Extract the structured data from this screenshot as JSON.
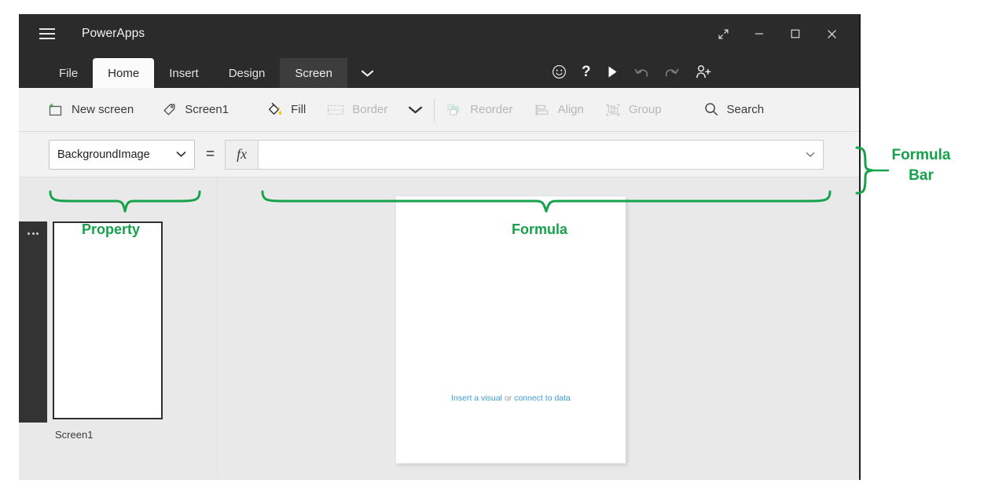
{
  "window": {
    "title": "PowerApps",
    "menu_icon": "hamburger-icon",
    "controls": [
      {
        "name": "restore-expand-button",
        "glyph": "⤢"
      },
      {
        "name": "minimize-button",
        "glyph": "—"
      },
      {
        "name": "maximize-button",
        "glyph": "▢"
      },
      {
        "name": "close-button",
        "glyph": "✕"
      }
    ]
  },
  "ribbon": {
    "tabs": [
      {
        "label": "File",
        "state": "normal"
      },
      {
        "label": "Home",
        "state": "active"
      },
      {
        "label": "Insert",
        "state": "normal"
      },
      {
        "label": "Design",
        "state": "normal"
      },
      {
        "label": "Screen",
        "state": "highlight"
      }
    ],
    "overflow_chevron": "❯",
    "actions": [
      {
        "name": "feedback-smiley-icon",
        "glyph": "☺",
        "state": "enabled"
      },
      {
        "name": "help-question-icon",
        "glyph": "?",
        "state": "enabled"
      },
      {
        "name": "play-preview-icon",
        "glyph": "▶",
        "state": "enabled"
      },
      {
        "name": "undo-icon",
        "glyph": "↺",
        "state": "disabled"
      },
      {
        "name": "redo-icon",
        "glyph": "↻",
        "state": "disabled"
      },
      {
        "name": "share-add-user-icon",
        "glyph": "",
        "state": "enabled"
      }
    ]
  },
  "toolbar": {
    "new_screen": "New screen",
    "screen_name": "Screen1",
    "fill": "Fill",
    "border": "Border",
    "more_chevron": "❯",
    "reorder": "Reorder",
    "align": "Align",
    "group": "Group",
    "search": "Search"
  },
  "formula_bar": {
    "property": "BackgroundImage",
    "property_chevron": "❯",
    "equals": "=",
    "fx_label": "fx",
    "formula_value": "",
    "formula_placeholder": "",
    "input_chevron": "❯"
  },
  "left_panel": {
    "thumb_menu_icon": "ellipsis-icon",
    "screen_label": "Screen1"
  },
  "canvas": {
    "hint_prefix": "Insert a visual",
    "hint_middle": "or",
    "hint_suffix": "connect to data"
  },
  "annotations": {
    "property": "Property",
    "formula": "Formula",
    "formula_bar_line1": "Formula",
    "formula_bar_line2": "Bar",
    "color": "#15a24a"
  }
}
